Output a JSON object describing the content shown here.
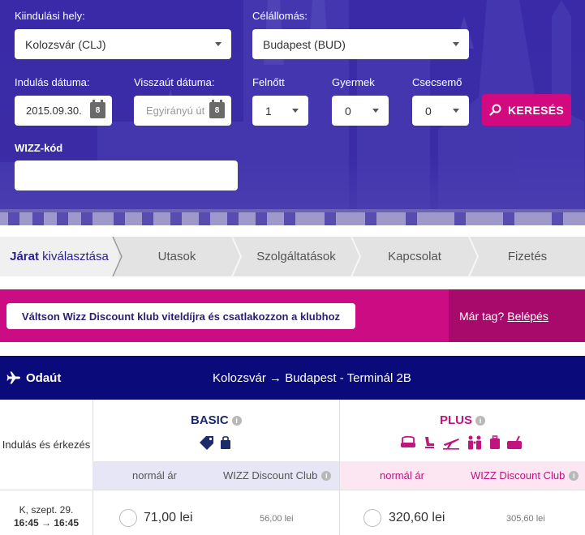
{
  "search": {
    "from_label": "Kiindulási hely:",
    "from_value": "Kolozsvár (CLJ)",
    "to_label": "Célállomás:",
    "to_value": "Budapest (BUD)",
    "depart_label": "Indulás dátuma:",
    "depart_value": "2015.09.30.",
    "return_label": "Visszaút dátuma:",
    "return_placeholder": "Egyirányú út",
    "calendar_day": "8",
    "adult_label": "Felnőtt",
    "adult_value": "1",
    "child_label": "Gyermek",
    "child_value": "0",
    "infant_label": "Csecsemő",
    "infant_value": "0",
    "search_button": "KERESÉS",
    "wizz_code_label": "WIZZ-kód",
    "wizz_code_value": ""
  },
  "steps": [
    {
      "label_bold": "Járat",
      "label_rest": " kiválasztása"
    },
    {
      "label": "Utasok"
    },
    {
      "label": "Szolgáltatások"
    },
    {
      "label": "Kapcsolat"
    },
    {
      "label": "Fizetés"
    }
  ],
  "promo": {
    "button": "Váltson Wizz Discount klub viteldíjra és csatlakozzon a klubhoz",
    "member_text": "Már tag?",
    "login_link": "Belépés"
  },
  "flight": {
    "direction": "Odaút",
    "route": "Kolozsvár → Budapest - Terminál 2B"
  },
  "fares": {
    "row_label": "Indulás és érkezés",
    "basic": {
      "name": "BASIC",
      "normal": "normál ár",
      "club": "WIZZ Discount Club",
      "price": "71,00 lei",
      "club_price": "56,00 lei"
    },
    "plus": {
      "name": "PLUS",
      "normal": "normál ár",
      "club": "WIZZ Discount Club",
      "price": "320,60 lei",
      "club_price": "305,60 lei"
    },
    "date": "K, szept. 29.",
    "times": "16:45 → 16:45",
    "info_glyph": "i"
  },
  "colors": {
    "hero": "#3b2ca6",
    "magenta": "#cc0c82",
    "navy": "#0b0a7a",
    "basic": "#1c2a6e",
    "plus": "#c0157f"
  }
}
